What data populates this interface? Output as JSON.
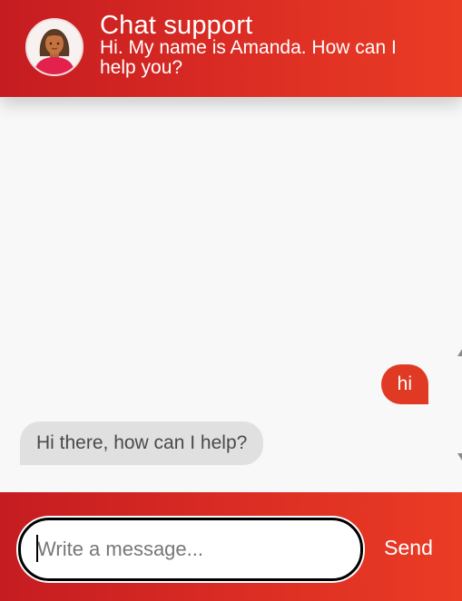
{
  "header": {
    "title": "Chat support",
    "subtitle": "Hi. My name is Amanda. How can I help you?",
    "avatar_icon": "woman-avatar-icon"
  },
  "messages": [
    {
      "from": "user",
      "text": "hi"
    },
    {
      "from": "agent",
      "text": "Hi there, how can I help?"
    }
  ],
  "composer": {
    "placeholder": "Write a message...",
    "value": "",
    "send_label": "Send"
  },
  "colors": {
    "brand_red": "#d9261f",
    "user_bubble": "#e03a24",
    "agent_bubble": "#e0e0e0"
  }
}
